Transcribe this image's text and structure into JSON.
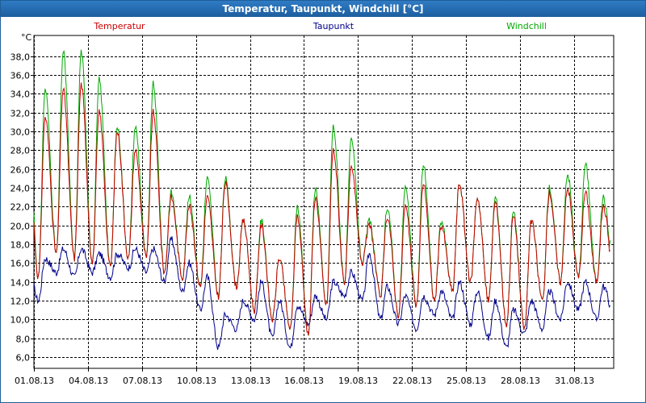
{
  "window": {
    "title": "Temperatur, Taupunkt, Windchill [°C]"
  },
  "colors": {
    "temperatur": "#cc0000",
    "taupunkt": "#00008b",
    "windchill": "#00aa00",
    "grid": "#000000",
    "titlebar": "#1d5f9f"
  },
  "chart_data": {
    "type": "line",
    "title": "Temperatur, Taupunkt, Windchill [°C]",
    "ylabel": "°C",
    "xlabel": "",
    "ylim": [
      4.8,
      40.2
    ],
    "xlim_days": [
      1,
      33.2
    ],
    "y_ticks": [
      "6,0",
      "8,0",
      "10,0",
      "12,0",
      "14,0",
      "16,0",
      "18,0",
      "20,0",
      "22,0",
      "24,0",
      "26,0",
      "28,0",
      "30,0",
      "32,0",
      "34,0",
      "36,0",
      "38,0"
    ],
    "x_ticks": [
      {
        "day": 1,
        "label": "01.08.13"
      },
      {
        "day": 4,
        "label": "04.08.13"
      },
      {
        "day": 7,
        "label": "07.08.13"
      },
      {
        "day": 10,
        "label": "10.08.13"
      },
      {
        "day": 13,
        "label": "13.08.13"
      },
      {
        "day": 16,
        "label": "16.08.13"
      },
      {
        "day": 19,
        "label": "19.08.13"
      },
      {
        "day": 22,
        "label": "22.08.13"
      },
      {
        "day": 25,
        "label": "25.08.13"
      },
      {
        "day": 28,
        "label": "28.08.13"
      },
      {
        "day": 31,
        "label": "31.08.13"
      }
    ],
    "grid": true,
    "legend": "top",
    "daily_temperatur": {
      "min": [
        14.5,
        17.0,
        16.5,
        16.0,
        15.5,
        16.5,
        16.5,
        15.0,
        14.5,
        13.5,
        12.5,
        13.5,
        11.0,
        10.0,
        9.0,
        8.5,
        11.5,
        14.0,
        16.0,
        12.5,
        10.5,
        11.5,
        12.0,
        13.0,
        14.0,
        12.0,
        9.5,
        9.0,
        12.0,
        14.0,
        14.5,
        14.0
      ],
      "max": [
        31.5,
        34.5,
        35.0,
        32.0,
        30.0,
        28.0,
        32.0,
        23.0,
        22.0,
        23.0,
        24.5,
        20.5,
        20.0,
        16.5,
        21.0,
        23.0,
        28.0,
        26.0,
        20.0,
        21.0,
        22.0,
        24.5,
        20.0,
        24.5,
        23.0,
        22.5,
        21.0,
        20.5,
        23.5,
        24.0,
        23.5,
        22.0
      ]
    },
    "daily_windchill": {
      "max": [
        34.5,
        38.5,
        38.5,
        35.5,
        30.5,
        30.5,
        35.0,
        23.5,
        23.0,
        25.0,
        25.0,
        20.5,
        20.5,
        16.5,
        22.0,
        24.0,
        30.5,
        29.0,
        20.5,
        22.0,
        24.0,
        26.5,
        20.5,
        24.5,
        23.0,
        23.0,
        21.5,
        20.5,
        24.0,
        25.5,
        26.5,
        23.0
      ]
    },
    "daily_taupunkt": {
      "min": [
        12.0,
        15.0,
        14.5,
        15.0,
        14.5,
        15.5,
        15.0,
        14.0,
        13.0,
        11.0,
        7.0,
        9.0,
        10.0,
        8.0,
        7.0,
        9.5,
        10.0,
        12.5,
        12.0,
        10.0,
        9.5,
        9.0,
        10.5,
        10.0,
        9.5,
        8.0,
        7.0,
        8.5,
        9.0,
        10.0,
        11.0,
        10.0
      ],
      "max": [
        16.5,
        17.5,
        17.5,
        17.0,
        17.0,
        17.5,
        17.5,
        18.5,
        16.0,
        14.5,
        10.5,
        12.0,
        14.0,
        12.0,
        11.5,
        12.5,
        14.0,
        15.0,
        17.0,
        13.5,
        12.5,
        12.5,
        13.0,
        14.0,
        13.0,
        12.0,
        11.0,
        12.0,
        13.0,
        14.0,
        14.0,
        13.5
      ]
    },
    "series": [
      {
        "name": "Temperatur"
      },
      {
        "name": "Taupunkt"
      },
      {
        "name": "Windchill"
      }
    ]
  }
}
